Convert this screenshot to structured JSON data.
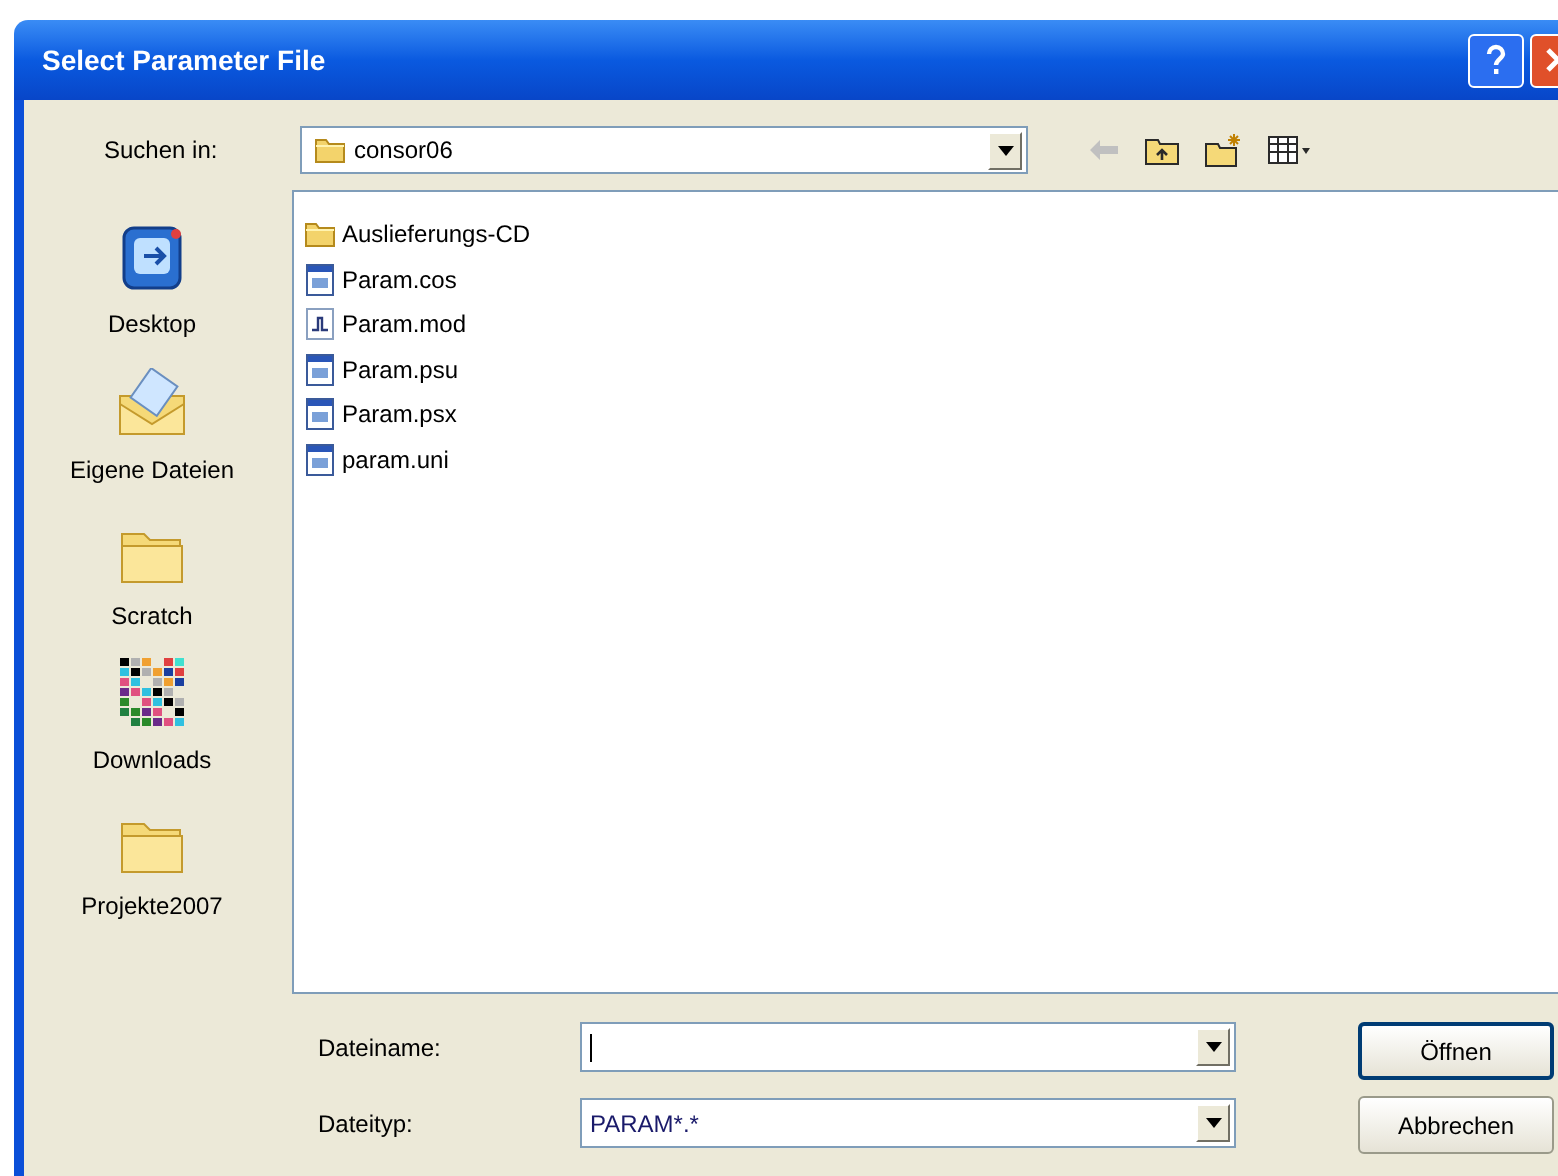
{
  "window": {
    "title": "Select Parameter File"
  },
  "look_in": {
    "label": "Suchen in:",
    "value": "consor06"
  },
  "toolbar": [
    {
      "kind": "back",
      "disabled": true
    },
    {
      "kind": "up",
      "disabled": false
    },
    {
      "kind": "new_folder",
      "disabled": false
    },
    {
      "kind": "views",
      "disabled": false
    }
  ],
  "places": [
    {
      "kind": "desktop",
      "label": "Desktop"
    },
    {
      "kind": "documents",
      "label": "Eigene Dateien"
    },
    {
      "kind": "folder",
      "label": "Scratch"
    },
    {
      "kind": "downloads",
      "label": "Downloads"
    },
    {
      "kind": "folder",
      "label": "Projekte2007"
    }
  ],
  "files": [
    {
      "kind": "folder",
      "name": "Auslieferungs-CD"
    },
    {
      "kind": "doc",
      "name": "Param.cos"
    },
    {
      "kind": "mod",
      "name": "Param.mod"
    },
    {
      "kind": "doc",
      "name": "Param.psu"
    },
    {
      "kind": "doc",
      "name": "Param.psx"
    },
    {
      "kind": "doc",
      "name": "param.uni"
    }
  ],
  "file_name": {
    "label": "Dateiname:"
  },
  "file_type": {
    "label": "Dateityp:",
    "value": "PARAM*.*"
  },
  "buttons": [
    {
      "label": "Öffnen",
      "default": true
    },
    {
      "label": "Abbrechen",
      "default": false
    }
  ]
}
